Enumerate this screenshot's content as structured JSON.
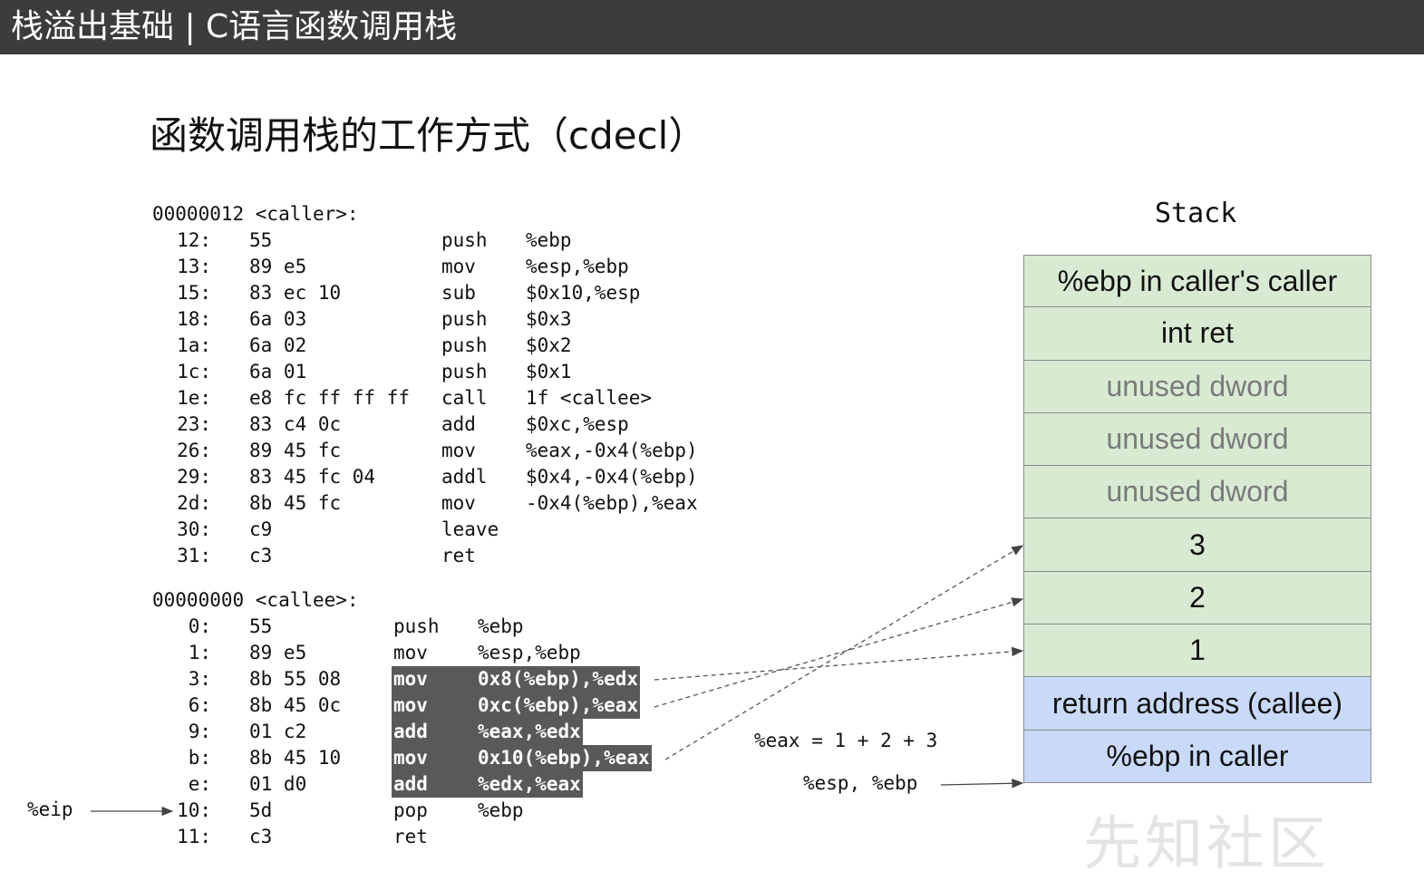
{
  "header": {
    "title": "栈溢出基础 | C语言函数调用栈"
  },
  "slide": {
    "title": "函数调用栈的工作方式（cdecl）"
  },
  "caller": {
    "header": "00000012 <caller>:",
    "rows": [
      {
        "addr": "12:",
        "bytes": "55",
        "op": "push",
        "args": "%ebp"
      },
      {
        "addr": "13:",
        "bytes": "89 e5",
        "op": "mov",
        "args": "%esp,%ebp"
      },
      {
        "addr": "15:",
        "bytes": "83 ec 10",
        "op": "sub",
        "args": "$0x10,%esp"
      },
      {
        "addr": "18:",
        "bytes": "6a 03",
        "op": "push",
        "args": "$0x3"
      },
      {
        "addr": "1a:",
        "bytes": "6a 02",
        "op": "push",
        "args": "$0x2"
      },
      {
        "addr": "1c:",
        "bytes": "6a 01",
        "op": "push",
        "args": "$0x1"
      },
      {
        "addr": "1e:",
        "bytes": "e8 fc ff ff ff",
        "op": "call",
        "args": "1f <callee>"
      },
      {
        "addr": "23:",
        "bytes": "83 c4 0c",
        "op": "add",
        "args": "$0xc,%esp"
      },
      {
        "addr": "26:",
        "bytes": "89 45 fc",
        "op": "mov",
        "args": "%eax,-0x4(%ebp)"
      },
      {
        "addr": "29:",
        "bytes": "83 45 fc 04",
        "op": "addl",
        "args": "$0x4,-0x4(%ebp)"
      },
      {
        "addr": "2d:",
        "bytes": "8b 45 fc",
        "op": "mov",
        "args": "-0x4(%ebp),%eax"
      },
      {
        "addr": "30:",
        "bytes": "c9",
        "op": "leave",
        "args": ""
      },
      {
        "addr": "31:",
        "bytes": "c3",
        "op": "ret",
        "args": ""
      }
    ]
  },
  "callee": {
    "header": "00000000 <callee>:",
    "rows": [
      {
        "addr": "0:",
        "bytes": "55",
        "op": "push",
        "args": "%ebp",
        "highlight": false
      },
      {
        "addr": "1:",
        "bytes": "89 e5",
        "op": "mov",
        "args": "%esp,%ebp",
        "highlight": false
      },
      {
        "addr": "3:",
        "bytes": "8b 55 08",
        "op": "mov",
        "args": "0x8(%ebp),%edx",
        "highlight": true
      },
      {
        "addr": "6:",
        "bytes": "8b 45 0c",
        "op": "mov",
        "args": "0xc(%ebp),%eax",
        "highlight": true
      },
      {
        "addr": "9:",
        "bytes": "01 c2",
        "op": "add",
        "args": "%eax,%edx",
        "highlight": true
      },
      {
        "addr": "b:",
        "bytes": "8b 45 10",
        "op": "mov",
        "args": "0x10(%ebp),%eax",
        "highlight": true
      },
      {
        "addr": "e:",
        "bytes": "01 d0",
        "op": "add",
        "args": "%edx,%eax",
        "highlight": true
      },
      {
        "addr": "10:",
        "bytes": "5d",
        "op": "pop",
        "args": "%ebp",
        "highlight": false
      },
      {
        "addr": "11:",
        "bytes": "c3",
        "op": "ret",
        "args": "",
        "highlight": false
      }
    ]
  },
  "stack": {
    "heading": "Stack",
    "cells": [
      {
        "label": "%ebp in caller's caller",
        "color": "green",
        "muted": false
      },
      {
        "label": "int ret",
        "color": "green",
        "muted": false
      },
      {
        "label": "unused dword",
        "color": "green",
        "muted": true
      },
      {
        "label": "unused dword",
        "color": "green",
        "muted": true
      },
      {
        "label": "unused dword",
        "color": "green",
        "muted": true
      },
      {
        "label": "3",
        "color": "green",
        "muted": false
      },
      {
        "label": "2",
        "color": "green",
        "muted": false
      },
      {
        "label": "1",
        "color": "green",
        "muted": false
      },
      {
        "label": "return address (callee)",
        "color": "blue",
        "muted": false
      },
      {
        "label": "%ebp in caller",
        "color": "blue",
        "muted": false
      }
    ]
  },
  "annotations": {
    "eip": "%eip",
    "eax_sum": "%eax = 1 + 2 + 3",
    "esp_ebp": "%esp, %ebp"
  },
  "watermark": "先知社区",
  "colors": {
    "topbar": "#3c3c3c",
    "highlight": "#595959",
    "stack_green": "#d9ead3",
    "stack_blue": "#c9daf8"
  }
}
